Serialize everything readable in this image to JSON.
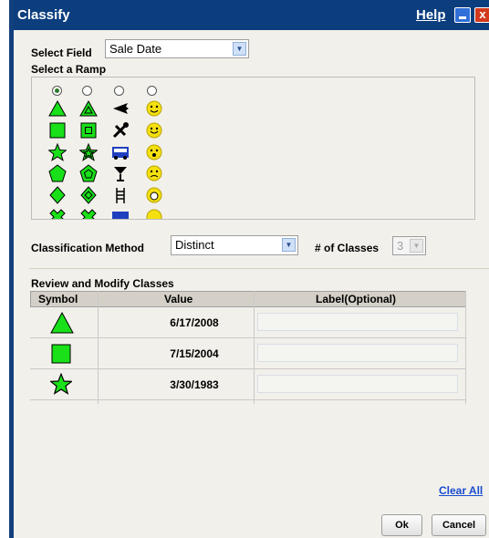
{
  "window": {
    "title": "Classify",
    "help_label": "Help",
    "min_icon": "minimize-icon",
    "close_icon": "close-icon",
    "close_glyph": "x"
  },
  "select_field": {
    "label": "Select Field",
    "value": "Sale Date"
  },
  "ramp": {
    "label": "Select a Ramp",
    "selected_index": 0
  },
  "classification": {
    "method_label": "Classification Method",
    "method_value": "Distinct",
    "num_classes_label": "# of Classes",
    "num_classes_value": "3"
  },
  "review": {
    "title": "Review and Modify Classes",
    "columns": [
      "Symbol",
      "Value",
      "Label(Optional)"
    ],
    "rows": [
      {
        "symbol": "triangle",
        "value": "6/17/2008",
        "label": ""
      },
      {
        "symbol": "square",
        "value": "7/15/2004",
        "label": ""
      },
      {
        "symbol": "star",
        "value": "3/30/1983",
        "label": ""
      }
    ]
  },
  "actions": {
    "clear_all": "Clear All",
    "ok": "Ok",
    "cancel": "Cancel"
  },
  "colors": {
    "accent_green": "#19e019",
    "title_blue": "#0c3e7e",
    "link_blue": "#1a4cd1"
  }
}
